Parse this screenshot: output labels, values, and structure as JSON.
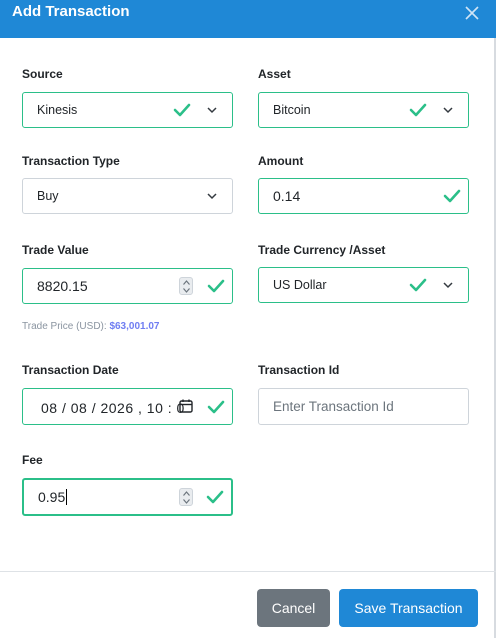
{
  "header": {
    "title": "Add Transaction"
  },
  "source": {
    "label": "Source",
    "value": "Kinesis"
  },
  "asset": {
    "label": "Asset",
    "value": "Bitcoin"
  },
  "transaction_type": {
    "label": "Transaction Type",
    "value": "Buy"
  },
  "amount": {
    "label": "Amount",
    "value": "0.14"
  },
  "trade_value": {
    "label": "Trade Value",
    "value": "8820.15"
  },
  "trade_currency": {
    "label": "Trade Currency /Asset",
    "value": "US Dollar"
  },
  "trade_price": {
    "prefix": "Trade Price (USD):",
    "value": "$63,001.07"
  },
  "transaction_date": {
    "label": "Transaction Date",
    "value": "08 / 08 / 2026 ,  10 : 0"
  },
  "transaction_id": {
    "label": "Transaction Id",
    "placeholder": "Enter Transaction Id"
  },
  "fee": {
    "label": "Fee",
    "value": "0.95"
  },
  "footer": {
    "cancel_label": "Cancel",
    "save_label": "Save Transaction"
  },
  "colors": {
    "header": "#1f88d6",
    "valid": "#2bbf89",
    "cancel": "#6c757d",
    "save": "#1f88d6",
    "trade_price": "#6f7df2"
  }
}
